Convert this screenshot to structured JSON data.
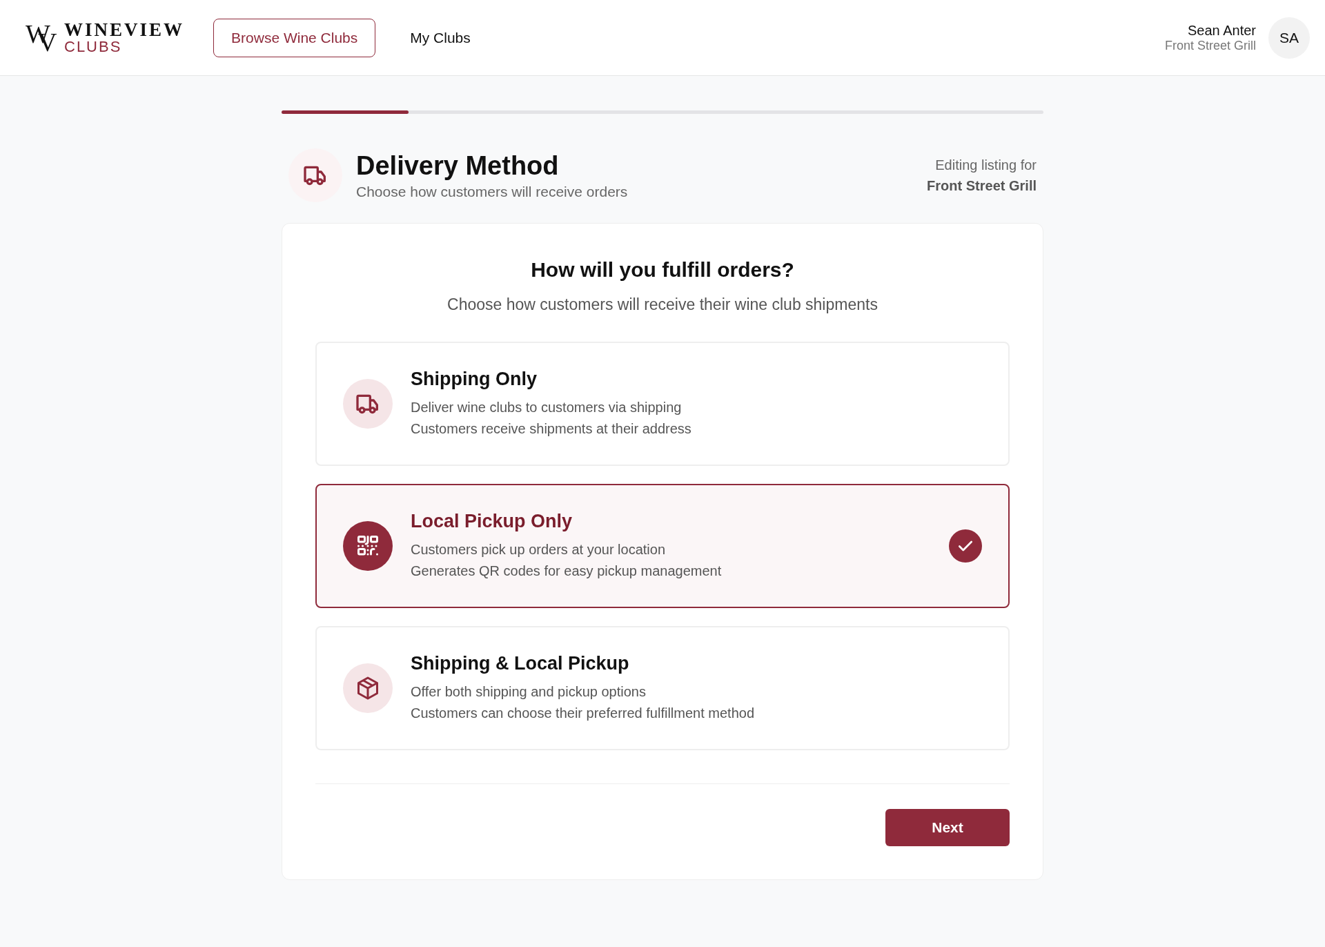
{
  "header": {
    "logo": {
      "monogram": [
        "W",
        "V"
      ],
      "wordmark": "WINEVIEW",
      "sub": "CLUBS"
    },
    "nav": [
      {
        "label": "Browse Wine Clubs",
        "selected": true
      },
      {
        "label": "My Clubs",
        "selected": false
      }
    ],
    "user": {
      "name": "Sean Anter",
      "org": "Front Street Grill",
      "initials": "SA"
    }
  },
  "progress": {
    "level": 0.167
  },
  "page": {
    "title": "Delivery Method",
    "subtitle": "Choose how customers will receive orders",
    "editing_label": "Editing listing for",
    "editing_name": "Front Street Grill"
  },
  "card": {
    "heading": "How will you fulfill orders?",
    "subheading": "Choose how customers will receive their wine club shipments",
    "options": [
      {
        "kind": "truck",
        "title": "Shipping Only",
        "lines": [
          "Deliver wine clubs to customers via shipping",
          "Customers receive shipments at their address"
        ],
        "selected": false
      },
      {
        "kind": "qr",
        "title": "Local Pickup Only",
        "lines": [
          "Customers pick up orders at your location",
          "Generates QR codes for easy pickup management"
        ],
        "selected": true
      },
      {
        "kind": "box",
        "title": "Shipping & Local Pickup",
        "lines": [
          "Offer both shipping and pickup options",
          "Customers can choose their preferred fulfillment method"
        ],
        "selected": false
      }
    ],
    "next_button": "Next"
  }
}
